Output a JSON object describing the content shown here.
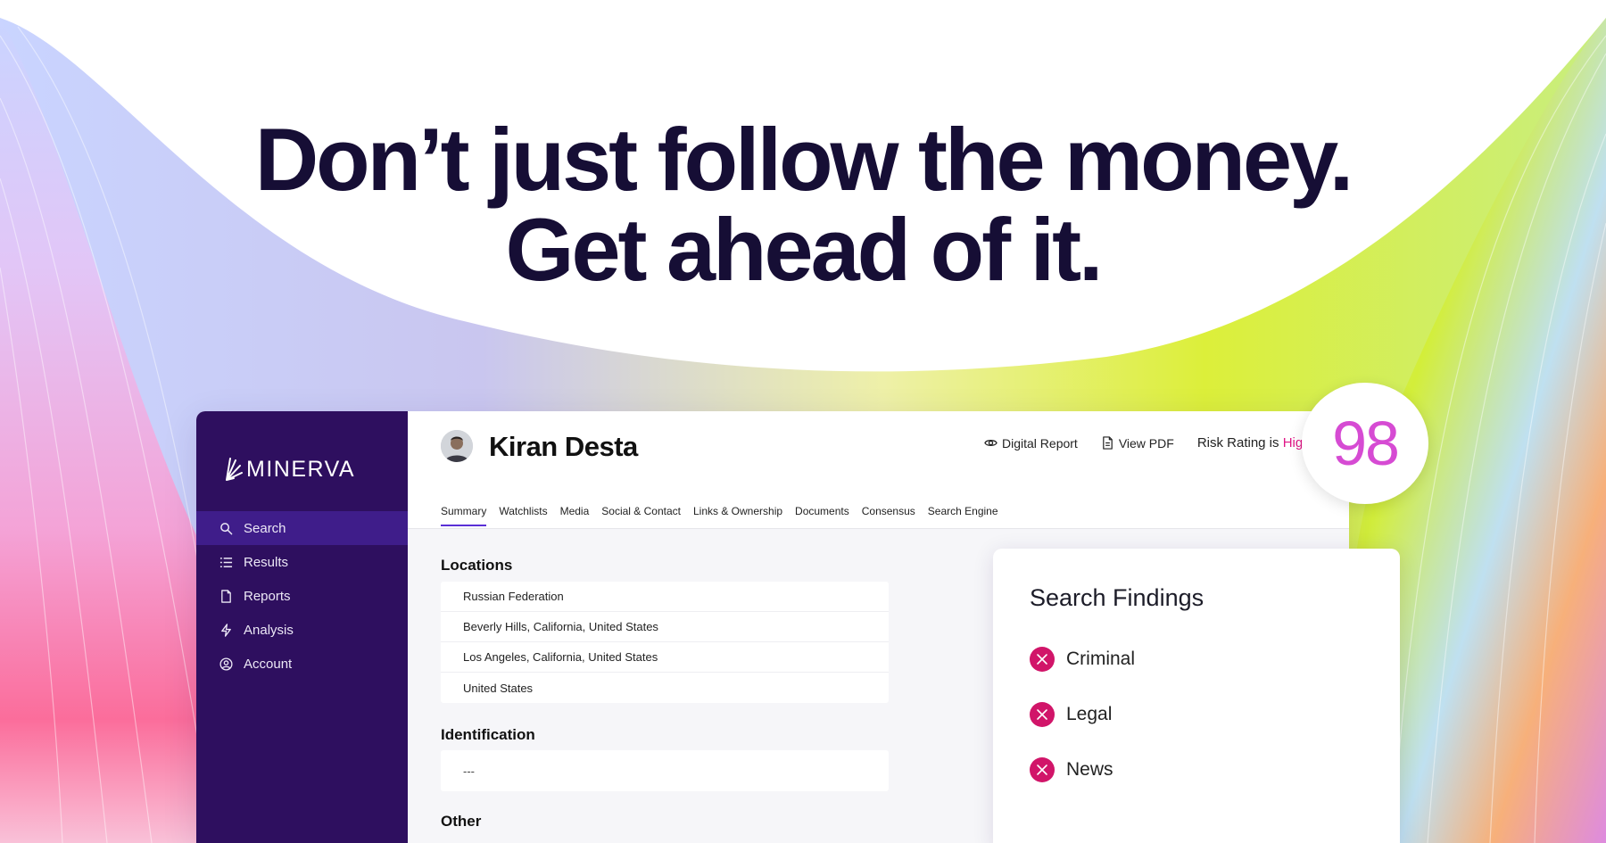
{
  "hero": {
    "line1": "Don’t just follow the money.",
    "line2": "Get ahead of it."
  },
  "brand": {
    "name": "MINERVA",
    "logo_icon": "minerva-leaf-logo"
  },
  "sidebar": {
    "items": [
      {
        "label": "Search",
        "icon": "search-icon",
        "active": true
      },
      {
        "label": "Results",
        "icon": "list-icon",
        "active": false
      },
      {
        "label": "Reports",
        "icon": "document-icon",
        "active": false
      },
      {
        "label": "Analysis",
        "icon": "bolt-icon",
        "active": false
      },
      {
        "label": "Account",
        "icon": "user-circle-icon",
        "active": false
      }
    ]
  },
  "profile": {
    "name": "Kiran Desta",
    "digital_report": "Digital Report",
    "view_pdf": "View PDF",
    "risk_prefix": "Risk Rating is",
    "risk_level": "High",
    "score": "98"
  },
  "tabs": [
    {
      "label": "Summary",
      "active": true
    },
    {
      "label": "Watchlists",
      "active": false
    },
    {
      "label": "Media",
      "active": false
    },
    {
      "label": "Social & Contact",
      "active": false
    },
    {
      "label": "Links & Ownership",
      "active": false
    },
    {
      "label": "Documents",
      "active": false
    },
    {
      "label": "Consensus",
      "active": false
    },
    {
      "label": "Search Engine",
      "active": false
    }
  ],
  "locations": {
    "title": "Locations",
    "items": [
      "Russian Federation",
      "Beverly Hills, California, United States",
      "Los Angeles, California, United States",
      "United States"
    ]
  },
  "identification": {
    "title": "Identification",
    "value": "---"
  },
  "other": {
    "title": "Other"
  },
  "findings": {
    "title": "Search Findings",
    "items": [
      "Criminal",
      "Legal",
      "News"
    ]
  },
  "colors": {
    "sidebar": "#2e0f5f",
    "sidebar_active": "#3f1d8a",
    "accent": "#5a2fd6",
    "risk": "#e01686",
    "score": "#d64bd3",
    "finding_x": "#d11569"
  }
}
